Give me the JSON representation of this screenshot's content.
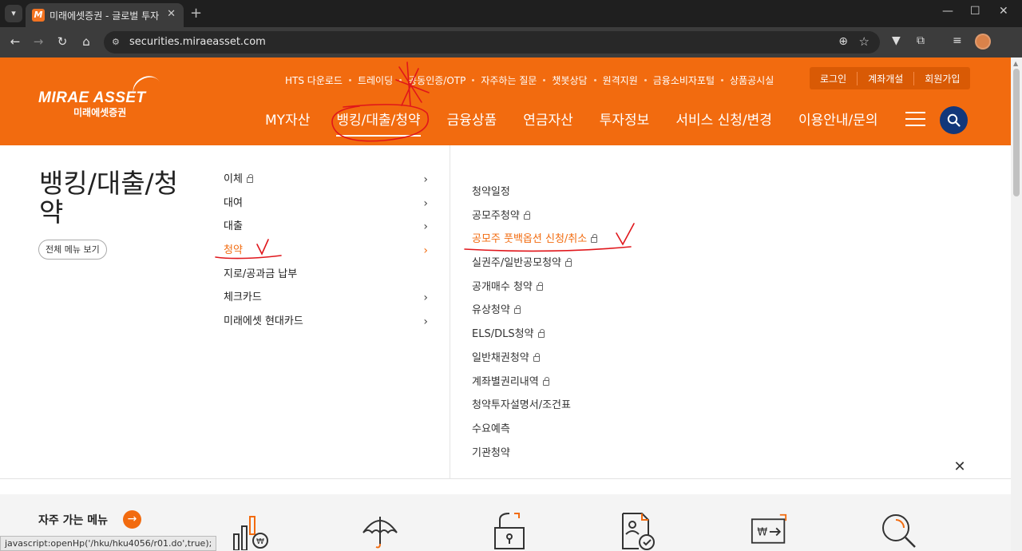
{
  "browser": {
    "tab_title": "미래에셋증권 - 글로벌 투자 파트너",
    "favicon_letter": "M",
    "url": "securities.miraeasset.com",
    "status_url": "javascript:openHp('/hku/hku4056/r01.do',true);"
  },
  "header": {
    "logo_en": "MIRAE ASSET",
    "logo_kr": "미래에셋증권",
    "utility_links": [
      "HTS 다운로드",
      "트레이딩",
      "공동인증/OTP",
      "자주하는 질문",
      "챗봇상담",
      "원격지원",
      "금융소비자포털",
      "상품공시실"
    ],
    "account_buttons": [
      "로그인",
      "계좌개설",
      "회원가입"
    ],
    "nav": [
      "MY자산",
      "뱅킹/대출/청약",
      "금융상품",
      "연금자산",
      "투자정보",
      "서비스 신청/변경",
      "이용안내/문의"
    ],
    "active_nav_index": 1
  },
  "panel": {
    "title": "뱅킹/대출/청약",
    "all_menu_label": "전체 메뉴 보기",
    "level2": [
      {
        "label": "이체",
        "lock": true,
        "chevron": true
      },
      {
        "label": "대여",
        "lock": false,
        "chevron": true
      },
      {
        "label": "대출",
        "lock": false,
        "chevron": true
      },
      {
        "label": "청약",
        "lock": false,
        "chevron": true,
        "active": true
      },
      {
        "label": "지로/공과금 납부",
        "lock": false,
        "chevron": false
      },
      {
        "label": "체크카드",
        "lock": false,
        "chevron": true
      },
      {
        "label": "미래에셋 현대카드",
        "lock": false,
        "chevron": true
      }
    ],
    "level3": [
      {
        "label": "청약일정",
        "lock": false
      },
      {
        "label": "공모주청약",
        "lock": true
      },
      {
        "label": "공모주 풋백옵션 신청/취소",
        "lock": true,
        "active": true
      },
      {
        "label": "실권주/일반공모청약",
        "lock": true
      },
      {
        "label": "공개매수 청약",
        "lock": true
      },
      {
        "label": "유상청약",
        "lock": true
      },
      {
        "label": "ELS/DLS청약",
        "lock": true
      },
      {
        "label": "일반채권청약",
        "lock": true
      },
      {
        "label": "계좌별권리내역",
        "lock": true
      },
      {
        "label": "청약투자설명서/조건표",
        "lock": false
      },
      {
        "label": "수요예측",
        "lock": false
      },
      {
        "label": "기관청약",
        "lock": false
      }
    ]
  },
  "frequent": {
    "title": "자주 가는 메뉴",
    "icons": [
      "chart-won-icon",
      "umbrella-icon",
      "lock-icon",
      "document-user-icon",
      "won-transfer-icon",
      "magnifier-icon"
    ]
  },
  "colors": {
    "brand_orange": "#f26b0f",
    "navy": "#12377a",
    "annotation_red": "#e0161b"
  }
}
